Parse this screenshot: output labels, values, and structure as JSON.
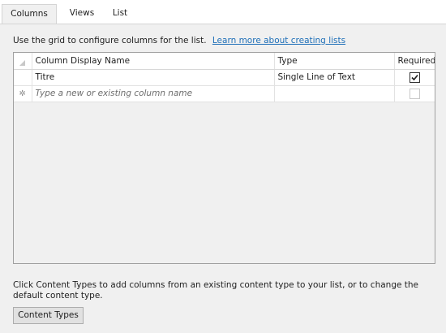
{
  "tabs": [
    {
      "label": "Columns",
      "active": true
    },
    {
      "label": "Views",
      "active": false
    },
    {
      "label": "List",
      "active": false
    }
  ],
  "intro": {
    "text": "Use the grid to configure columns for the list.",
    "link": "Learn more about creating lists"
  },
  "grid": {
    "headers": {
      "name": "Column Display Name",
      "type": "Type",
      "required": "Required"
    },
    "rows": [
      {
        "name": "Titre",
        "type": "Single Line of Text",
        "required": true
      }
    ],
    "new_row": {
      "placeholder": "Type a new or existing column name",
      "required": false
    }
  },
  "footer": {
    "note": "Click Content Types to add columns from an existing content type to your list, or to change the default content type.",
    "button": "Content Types"
  },
  "icons": {
    "corner": "header-corner-triangle-icon",
    "new_row": "new-row-star-icon",
    "checked": "checkmark-icon"
  },
  "colors": {
    "panel": "#f0f0f0",
    "link": "#1e6fb8",
    "grid_border": "#a0a0a0"
  }
}
